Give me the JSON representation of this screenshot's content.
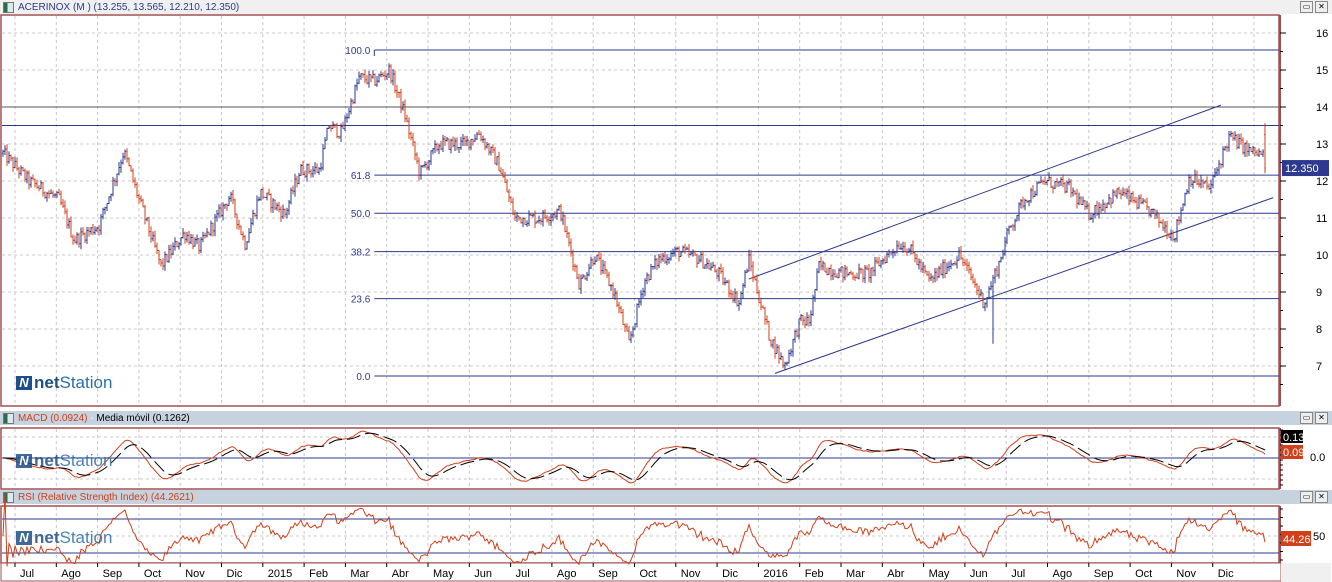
{
  "window": {
    "title": "ACERINOX (M ) (13.255, 13.565, 12.210, 12.350)",
    "restore_label": "▭",
    "close_label": "✕"
  },
  "logo": {
    "text_bold": "net",
    "text": "Station"
  },
  "macd": {
    "title": "MACD (0.0924)",
    "separator": " - ",
    "signal_title": "Media móvil (0.1262)",
    "signal_badge": "0.13",
    "macd_badge": "0.09",
    "zero_label": "0.0",
    "colors": {
      "macd": "#d0401b",
      "signal": "#000000"
    }
  },
  "rsi": {
    "title": "RSI (Relative Strength Index) (44.2621)",
    "badge": "44.26",
    "mid_label": "50",
    "color": "#d0401b"
  },
  "colors": {
    "up": "#2b3a8f",
    "down": "#d0401b",
    "level": "#2b3a8f",
    "frame": "#a05050",
    "badge": "#2b3a8f"
  },
  "chart_data": {
    "type": "ohlc",
    "title": "ACERINOX (M )",
    "last": {
      "open": 13.255,
      "high": 13.565,
      "low": 12.21,
      "close": 12.35
    },
    "price_label": "12.350",
    "yticks": [
      "7",
      "8",
      "9",
      "10",
      "11",
      "12",
      "13",
      "14",
      "15",
      "16"
    ],
    "ylim": [
      6.5,
      16.5
    ],
    "grid": true,
    "xticks": [
      "Jul",
      "Ago",
      "Sep",
      "Oct",
      "Nov",
      "Dic",
      "2015",
      "Feb",
      "Mar",
      "Abr",
      "May",
      "Jun",
      "Jul",
      "Ago",
      "Sep",
      "Oct",
      "Nov",
      "Dic",
      "2016",
      "Feb",
      "Mar",
      "Abr",
      "May",
      "Jun",
      "Jul",
      "Ago",
      "Sep",
      "Oct",
      "Nov",
      "Dic"
    ],
    "closes": [
      [
        "2014-06-21",
        12.8
      ],
      [
        "2014-07-11",
        12.0
      ],
      [
        "2014-08-03",
        11.5
      ],
      [
        "2014-08-14",
        10.4
      ],
      [
        "2014-09-02",
        10.8
      ],
      [
        "2014-09-20",
        12.8
      ],
      [
        "2014-10-01",
        11.5
      ],
      [
        "2014-10-17",
        9.7
      ],
      [
        "2014-11-04",
        10.6
      ],
      [
        "2014-11-15",
        10.2
      ],
      [
        "2014-12-07",
        11.6
      ],
      [
        "2014-12-18",
        10.3
      ],
      [
        "2014-12-29",
        11.7
      ],
      [
        "2015-01-17",
        11.1
      ],
      [
        "2015-01-28",
        12.3
      ],
      [
        "2015-02-12",
        12.3
      ],
      [
        "2015-02-19",
        13.5
      ],
      [
        "2015-02-28",
        13.3
      ],
      [
        "2015-03-11",
        14.8
      ],
      [
        "2015-03-22",
        14.7
      ],
      [
        "2015-04-03",
        15.0
      ],
      [
        "2015-04-14",
        13.8
      ],
      [
        "2015-04-25",
        12.2
      ],
      [
        "2015-05-09",
        13.0
      ],
      [
        "2015-05-28",
        13.0
      ],
      [
        "2015-06-08",
        13.3
      ],
      [
        "2015-06-23",
        12.4
      ],
      [
        "2015-07-04",
        11.0
      ],
      [
        "2015-07-22",
        11.0
      ],
      [
        "2015-08-07",
        11.2
      ],
      [
        "2015-08-21",
        9.2
      ],
      [
        "2015-09-02",
        10.0
      ],
      [
        "2015-09-16",
        9.0
      ],
      [
        "2015-09-27",
        7.6
      ],
      [
        "2015-10-08",
        9.3
      ],
      [
        "2015-10-19",
        9.9
      ],
      [
        "2015-11-03",
        10.1
      ],
      [
        "2015-11-18",
        9.9
      ],
      [
        "2015-12-02",
        9.5
      ],
      [
        "2015-12-17",
        8.7
      ],
      [
        "2015-12-24",
        9.9
      ],
      [
        "2016-01-09",
        7.8
      ],
      [
        "2016-01-20",
        7.0
      ],
      [
        "2016-02-01",
        8.2
      ],
      [
        "2016-02-08",
        8.2
      ],
      [
        "2016-02-15",
        9.7
      ],
      [
        "2016-03-03",
        9.5
      ],
      [
        "2016-03-21",
        9.5
      ],
      [
        "2016-04-13",
        10.3
      ],
      [
        "2016-04-20",
        10.2
      ],
      [
        "2016-05-05",
        9.3
      ],
      [
        "2016-05-27",
        10.0
      ],
      [
        "2016-06-15",
        8.7
      ],
      [
        "2016-06-26",
        9.8
      ],
      [
        "2016-07-03",
        10.7
      ],
      [
        "2016-07-14",
        11.5
      ],
      [
        "2016-07-29",
        12.0
      ],
      [
        "2016-08-17",
        11.8
      ],
      [
        "2016-09-01",
        11.1
      ],
      [
        "2016-09-23",
        11.7
      ],
      [
        "2016-10-15",
        11.2
      ],
      [
        "2016-11-03",
        10.5
      ],
      [
        "2016-11-14",
        12.1
      ],
      [
        "2016-11-29",
        11.8
      ],
      [
        "2016-12-13",
        13.2
      ],
      [
        "2016-12-28",
        12.8
      ],
      [
        "2017-01-08",
        12.7
      ],
      [
        "2017-01-10",
        12.35
      ]
    ],
    "fibonacci": {
      "from": [
        "2015-03-22",
        15.54
      ],
      "to": [
        "2016-01-20",
        6.73
      ],
      "levels": [
        {
          "label": "100.0",
          "price": 15.54
        },
        {
          "label": "61.8",
          "price": 12.16
        },
        {
          "label": "50.0",
          "price": 11.13
        },
        {
          "label": "38.2",
          "price": 10.09
        },
        {
          "label": "23.6",
          "price": 8.82
        },
        {
          "label": "0.0",
          "price": 6.73
        }
      ]
    },
    "horizontal_lines": [
      {
        "price": 14.0,
        "color": "#555555"
      },
      {
        "price": 13.5,
        "color": "#2b3a8f"
      }
    ],
    "channel": {
      "upper": [
        [
          "2015-12-24",
          9.35
        ],
        [
          "2016-12-07",
          14.05
        ]
      ],
      "lower": [
        [
          "2016-01-13",
          6.8
        ],
        [
          "2017-01-15",
          11.55
        ]
      ]
    }
  }
}
